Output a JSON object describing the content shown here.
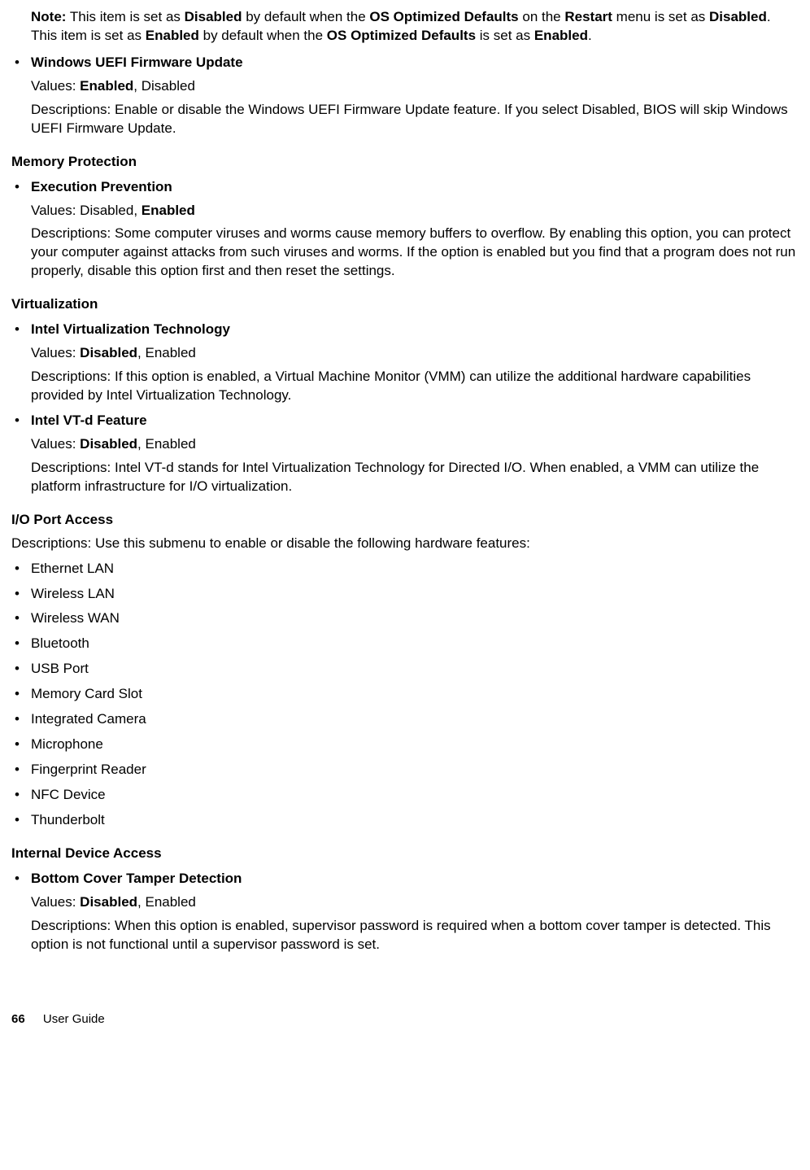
{
  "note": {
    "label": "Note:",
    "text_parts": [
      " This item is set as ",
      "Disabled",
      " by default when the ",
      "OS Optimized Defaults",
      " on the ",
      "Restart",
      " menu is set as ",
      "Disabled",
      ". This item is set as ",
      "Enabled",
      " by default when the ",
      "OS Optimized Defaults",
      " is set as ",
      "Enabled",
      "."
    ]
  },
  "top_item": {
    "title": "Windows UEFI Firmware Update",
    "values_prefix": "Values: ",
    "values_bold": "Enabled",
    "values_rest": ", Disabled",
    "description": "Descriptions: Enable or disable the Windows UEFI Firmware Update feature. If you select Disabled, BIOS will skip Windows UEFI Firmware Update."
  },
  "memory_protection": {
    "heading": "Memory Protection",
    "item": {
      "title": "Execution Prevention",
      "values_prefix": "Values: Disabled, ",
      "values_bold": "Enabled",
      "description": "Descriptions: Some computer viruses and worms cause memory buffers to overflow. By enabling this option, you can protect your computer against attacks from such viruses and worms. If the option is enabled but you find that a program does not run properly, disable this option first and then reset the settings."
    }
  },
  "virtualization": {
    "heading": "Virtualization",
    "items": [
      {
        "title": "Intel Virtualization Technology",
        "values_prefix": "Values: ",
        "values_bold": "Disabled",
        "values_rest": ", Enabled",
        "description": "Descriptions: If this option is enabled, a Virtual Machine Monitor (VMM) can utilize the additional hardware capabilities provided by Intel Virtualization Technology."
      },
      {
        "title": "Intel VT-d Feature",
        "values_prefix": "Values: ",
        "values_bold": "Disabled",
        "values_rest": ", Enabled",
        "description": "Descriptions: Intel VT-d stands for Intel Virtualization Technology for Directed I/O. When enabled, a VMM can utilize the platform infrastructure for I/O virtualization."
      }
    ]
  },
  "io_port_access": {
    "heading": "I/O Port Access",
    "description": "Descriptions: Use this submenu to enable or disable the following hardware features:",
    "features": [
      "Ethernet LAN",
      "Wireless LAN",
      "Wireless WAN",
      "Bluetooth",
      "USB Port",
      "Memory Card Slot",
      "Integrated Camera",
      "Microphone",
      "Fingerprint Reader",
      "NFC Device",
      "Thunderbolt"
    ]
  },
  "internal_device_access": {
    "heading": "Internal Device Access",
    "item": {
      "title": "Bottom Cover Tamper Detection",
      "values_prefix": "Values: ",
      "values_bold": "Disabled",
      "values_rest": ", Enabled",
      "description": "Descriptions: When this option is enabled, supervisor password is required when a bottom cover tamper is detected. This option is not functional until a supervisor password is set."
    }
  },
  "footer": {
    "page_number": "66",
    "label": "User Guide"
  }
}
